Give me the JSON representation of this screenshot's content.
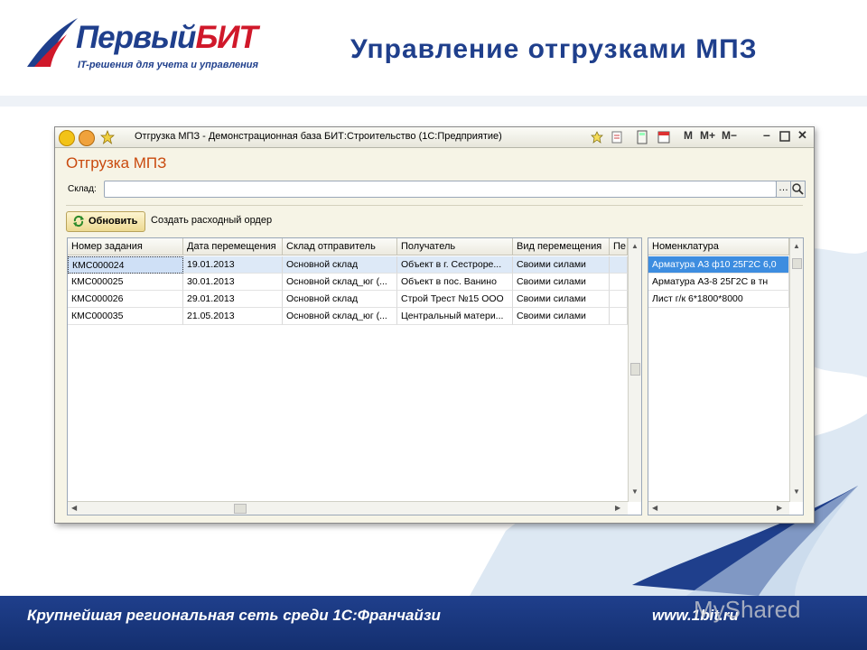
{
  "brand": {
    "name_part1": "Первый",
    "name_part2": "БИТ",
    "tagline": "IT-решения для учета и управления",
    "primary_color": "#1f3f8c",
    "accent_color": "#d0182a"
  },
  "slide_title": "Управление отгрузками МПЗ",
  "window": {
    "title": "Отгрузка МПЗ - Демонстрационная база БИТ:Строительство (1С:Предприятие)",
    "memory_buttons": [
      "M",
      "M+",
      "M−"
    ],
    "form_title": "Отгрузка МПЗ",
    "sklad_label": "Склад:",
    "sklad_value": "",
    "refresh_label": "Обновить",
    "create_order_label": "Создать расходный ордер"
  },
  "tasks_table": {
    "columns": [
      "Номер задания",
      "Дата перемещения",
      "Склад отправитель",
      "Получатель",
      "Вид перемещения",
      "Пе"
    ],
    "rows": [
      [
        "КМС000024",
        "19.01.2013",
        "Основной склад",
        "Объект в г. Сестроре...",
        "Своими силами",
        ""
      ],
      [
        "КМС000025",
        "30.01.2013",
        "Основной склад_юг (...",
        "Объект в пос. Ванино",
        "Своими силами",
        ""
      ],
      [
        "КМС000026",
        "29.01.2013",
        "Основной склад",
        "Строй Трест №15 ООО",
        "Своими силами",
        ""
      ],
      [
        "КМС000035",
        "21.05.2013",
        "Основной склад_юг (...",
        "Центральный матери...",
        "Своими силами",
        ""
      ]
    ],
    "selected_row": 0
  },
  "items_table": {
    "columns": [
      "Номенклатура"
    ],
    "rows": [
      [
        "Арматура А3 ф10 25Г2С 6,0"
      ],
      [
        "Арматура А3-8 25Г2С в тн"
      ],
      [
        "Лист г/к 6*1800*8000"
      ]
    ],
    "selected_row": 0
  },
  "footer": {
    "text": "Крупнейшая региональная сеть среди 1С:Франчайзи",
    "url": "www.1bit.ru"
  },
  "watermark": "MyShared"
}
